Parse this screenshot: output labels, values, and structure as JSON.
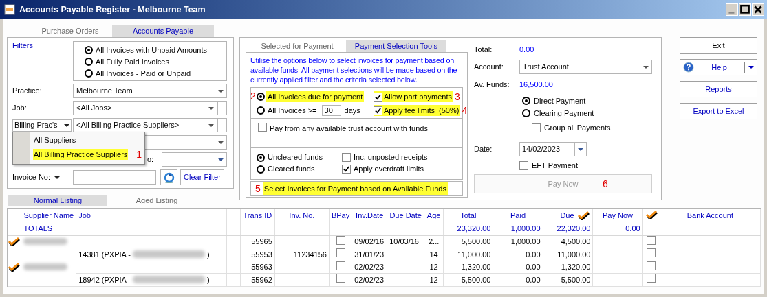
{
  "window": {
    "title": "Accounts Payable Register - Melbourne Team"
  },
  "main_tabs": [
    {
      "label": "Purchase Orders",
      "selected": false
    },
    {
      "label": "Accounts Payable",
      "selected": true
    }
  ],
  "filters": {
    "title": "Filters",
    "scope_options": [
      {
        "label": "All Invoices with Unpaid Amounts",
        "selected": true
      },
      {
        "label": "All Fully Paid Invoices",
        "selected": false
      },
      {
        "label": "All Invoices - Paid or Unpaid",
        "selected": false
      }
    ],
    "practice": {
      "label": "Practice:",
      "value": "Melbourne Team"
    },
    "job": {
      "label": "Job:",
      "value": "<All Jobs>"
    },
    "supplier_filter": {
      "label": "Billing Prac's",
      "value": "<All Billing Practice Suppliers>"
    },
    "date_to_label": "o:",
    "invoice_no": {
      "label": "Invoice No:"
    },
    "clear_button": "Clear Filter",
    "supplier_menu": [
      {
        "label": "All Suppliers",
        "highlighted": false
      },
      {
        "label": "All Billing Practice Suppliers",
        "highlighted": true,
        "annotation": "1"
      }
    ]
  },
  "payment_tabs": [
    {
      "label": "Selected for Payment",
      "selected": false
    },
    {
      "label": "Payment Selection Tools",
      "selected": true
    }
  ],
  "selection_tools": {
    "description": "Utilise the options below to select invoices for payment based on available funds.  All payment selections will be made based on the currently applied filter and the criteria selected below.",
    "due_options": [
      {
        "label": "All Invoices due for payment",
        "selected": true,
        "highlighted": true,
        "annotation": "2"
      },
      {
        "label": "All Invoices >=",
        "selected": false,
        "highlighted": false,
        "days": "30",
        "days_label": "days"
      }
    ],
    "limit_options": [
      {
        "label": "Allow part payments",
        "checked": true,
        "highlighted": true,
        "annotation": "3"
      },
      {
        "label": "Apply fee limits  (50%)",
        "checked": true,
        "highlighted": true,
        "annotation": "4"
      }
    ],
    "trust_option": {
      "label": "Pay from any available trust account with funds",
      "checked": false
    },
    "fund_options": [
      {
        "label": "Uncleared funds",
        "selected": true
      },
      {
        "label": "Cleared funds",
        "selected": false
      }
    ],
    "fund_checks": [
      {
        "label": "Inc. unposted receipts",
        "checked": false
      },
      {
        "label": "Apply overdraft limits",
        "checked": true
      }
    ],
    "select_button": {
      "label": "Select Invoices for Payment based on Available Funds",
      "highlighted": true,
      "annotation": "5"
    }
  },
  "payment": {
    "total_label": "Total:",
    "total": "0.00",
    "account_label": "Account:",
    "account": "Trust Account",
    "funds_label": "Av. Funds:",
    "funds": "16,500.00",
    "methods": [
      {
        "label": "Direct Payment",
        "selected": true
      },
      {
        "label": "Clearing Payment",
        "selected": false
      }
    ],
    "group_payments": {
      "label": "Group all Payments",
      "checked": false
    },
    "date_label": "Date:",
    "date": "14/02/2023",
    "eft": {
      "label": "EFT Payment",
      "checked": false
    },
    "pay_button": {
      "label": "Pay Now",
      "disabled": true,
      "annotation": "6"
    }
  },
  "actions": [
    {
      "kind": "plain",
      "before": "E",
      "key": "x",
      "after": "it"
    },
    {
      "kind": "split",
      "after": "Help"
    },
    {
      "kind": "plain",
      "key": "R",
      "after": "eports"
    },
    {
      "kind": "plain",
      "after": "Export to Excel"
    }
  ],
  "listing_tabs": [
    {
      "label": "Normal Listing",
      "selected": true
    },
    {
      "label": "Aged Listing",
      "selected": false
    }
  ],
  "grid": {
    "lead_columns": [
      {
        "label": "Supplier Name",
        "total": "TOTALS"
      },
      {
        "label": "Job"
      }
    ],
    "columns": [
      {
        "kind": "blank"
      },
      {
        "label": "Trans ID"
      },
      {
        "label": "Inv. No."
      },
      {
        "label": "BPay"
      },
      {
        "label": "Inv.Date"
      },
      {
        "label": "Due Date"
      },
      {
        "label": "Age"
      },
      {
        "label": "Total",
        "total": "23,320.00"
      },
      {
        "label": "Paid",
        "total": "1,000.00"
      },
      {
        "label": "Due",
        "total": "22,320.00",
        "check_icon": true
      },
      {
        "label": "Pay Now",
        "total": "0.00"
      },
      {
        "kind": "check"
      },
      {
        "label": "Bank Account"
      }
    ],
    "rows": [
      {
        "supplier_start": true,
        "flagged": true,
        "job": "14381 (PXPIA -",
        "job_tail": ")",
        "cells": [
          null,
          "55965",
          null,
          {
            "checked": false
          },
          "09/02/16",
          "10/03/16",
          "2...",
          "5,500.00",
          "1,000.00",
          "4,500.00",
          null,
          {
            "checked": false
          },
          null
        ]
      },
      {
        "supplier_start": true,
        "flagged": true,
        "cells": [
          null,
          "55953",
          "11234156",
          {
            "checked": false
          },
          "31/01/23",
          null,
          "14",
          "11,000.00",
          "0.00",
          "11,000.00",
          null,
          {
            "checked": false
          },
          null
        ]
      },
      {
        "supplier_start": false,
        "cells": [
          null,
          "55963",
          null,
          {
            "checked": false
          },
          "02/02/23",
          null,
          "12",
          "1,320.00",
          "0.00",
          "1,320.00",
          null,
          {
            "checked": false
          },
          null
        ]
      },
      {
        "supplier_start": false,
        "job": "18942 (PXPIA -",
        "job_tail": ")",
        "cells": [
          null,
          "55962",
          null,
          {
            "checked": false
          },
          "02/02/23",
          null,
          "12",
          "5,500.00",
          "0.00",
          "5,500.00",
          null,
          {
            "checked": false
          },
          null
        ]
      }
    ]
  }
}
